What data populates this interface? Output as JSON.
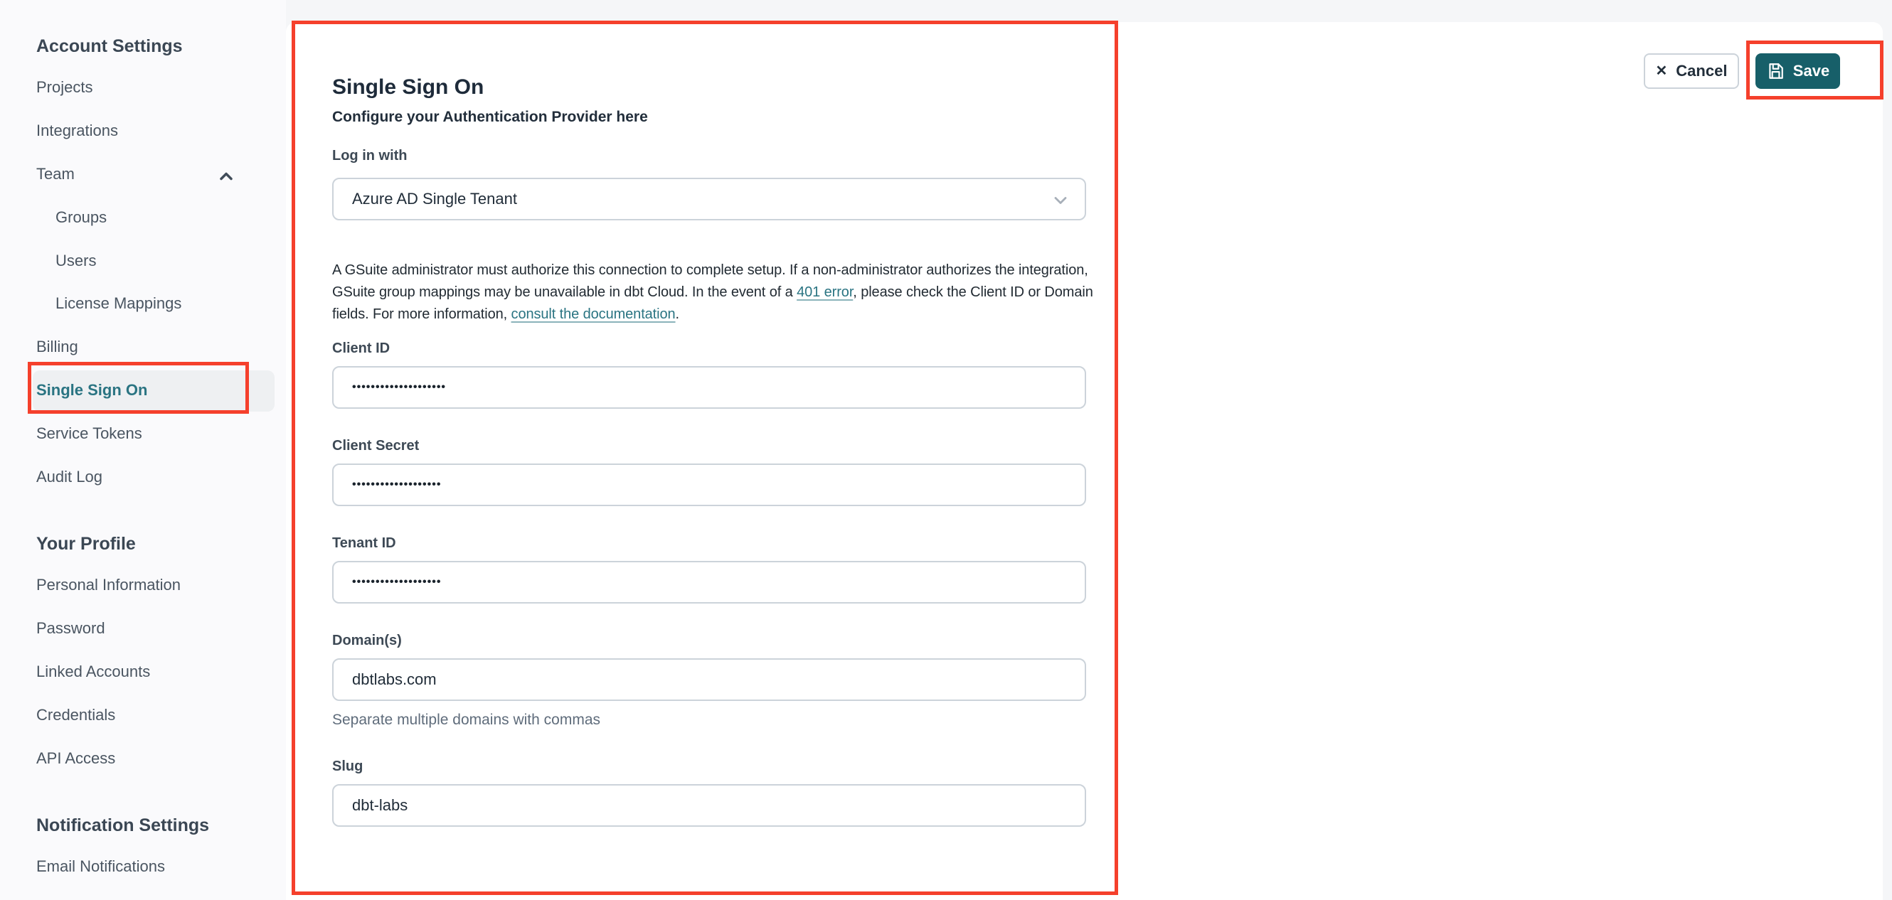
{
  "sidebar": {
    "sections": [
      {
        "header": "Account Settings",
        "items": [
          {
            "label": "Projects"
          },
          {
            "label": "Integrations"
          },
          {
            "label": "Team"
          },
          {
            "label": "Groups"
          },
          {
            "label": "Users"
          },
          {
            "label": "License Mappings"
          },
          {
            "label": "Billing"
          },
          {
            "label": "Single Sign On",
            "selected": true
          },
          {
            "label": "Service Tokens"
          },
          {
            "label": "Audit Log"
          }
        ]
      },
      {
        "header": "Your Profile",
        "items": [
          {
            "label": "Personal Information"
          },
          {
            "label": "Password"
          },
          {
            "label": "Linked Accounts"
          },
          {
            "label": "Credentials"
          },
          {
            "label": "API Access"
          }
        ]
      },
      {
        "header": "Notification Settings",
        "items": [
          {
            "label": "Email Notifications"
          }
        ]
      }
    ]
  },
  "main": {
    "title": "Single Sign On",
    "subtitle": "Configure your Authentication Provider here",
    "login_with": {
      "label": "Log in with",
      "value": "Azure AD Single Tenant"
    },
    "notice": {
      "part1": "A GSuite administrator must authorize this connection to complete setup. If a non-administrator authorizes the integration, GSuite group mappings may be unavailable in dbt Cloud. In the event of a ",
      "link1": "401 error",
      "part2": ", please check the Client ID or Domain fields. For more information, ",
      "link2": "consult the documentation",
      "part3": "."
    },
    "fields": [
      {
        "label": "Client ID",
        "value": "••••••••••••••••••••",
        "masked": true
      },
      {
        "label": "Client Secret",
        "value": "•••••••••••••••••••",
        "masked": true
      },
      {
        "label": "Tenant ID",
        "value": "•••••••••••••••••••",
        "masked": true
      },
      {
        "label": "Domain(s)",
        "value": "dbtlabs.com",
        "helper": "Separate multiple domains with commas"
      },
      {
        "label": "Slug",
        "value": "dbt-labs"
      }
    ]
  },
  "actions": {
    "cancel_label": "Cancel",
    "cancel_icon": "✕",
    "save_label": "Save"
  },
  "colors": {
    "accent_teal": "#2a7482",
    "save_button_teal": "#175f69",
    "annotation_red": "#f5402c",
    "selected_item_bg": "#eef0f2",
    "page_bg": "#f5f6f8",
    "card_bg": "#ffffff"
  }
}
